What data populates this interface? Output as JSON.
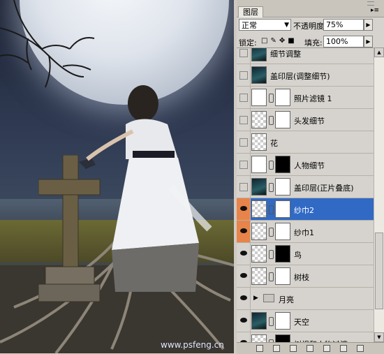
{
  "canvas": {
    "watermark": "www.psfeng.cn"
  },
  "panel": {
    "tab_label": "图层",
    "menu_icon": "panel-menu-icon",
    "blend_mode": "正常",
    "opacity_label": "不透明度:",
    "opacity_value": "75%",
    "lock_label": "锁定:",
    "fill_label": "填充:",
    "fill_value": "100%"
  },
  "layers": [
    {
      "name": "细节调整",
      "visible": false,
      "thumb": "image",
      "mask": null,
      "active": false
    },
    {
      "name": "盖印层(调整细节)",
      "visible": false,
      "thumb": "image",
      "mask": null,
      "active": false
    },
    {
      "name": "照片滤镜 1",
      "visible": false,
      "thumb": "adjustment",
      "mask": "white",
      "active": false
    },
    {
      "name": "头发细节",
      "visible": false,
      "thumb": "checker",
      "mask": "white",
      "active": false
    },
    {
      "name": "花",
      "visible": false,
      "thumb": "checker",
      "mask": null,
      "active": false
    },
    {
      "name": "人物细节",
      "visible": false,
      "thumb": "histogram",
      "mask": "black",
      "active": false
    },
    {
      "name": "盖印层(正片叠底)",
      "visible": false,
      "thumb": "image",
      "mask": "white",
      "active": false
    },
    {
      "name": "纱巾2",
      "visible": true,
      "thumb": "checker",
      "mask": "white",
      "active": true
    },
    {
      "name": "纱巾1",
      "visible": true,
      "thumb": "checker",
      "mask": "white",
      "active": false
    },
    {
      "name": "鸟",
      "visible": true,
      "thumb": "checker",
      "mask": "black",
      "active": false
    },
    {
      "name": "树枝",
      "visible": true,
      "thumb": "checker",
      "mask": "white",
      "active": false
    },
    {
      "name": "月亮",
      "visible": true,
      "thumb": "folder",
      "mask": null,
      "active": false
    },
    {
      "name": "天空",
      "visible": true,
      "thumb": "image",
      "mask": "white",
      "active": false
    },
    {
      "name": "树根和人物过渡",
      "visible": true,
      "thumb": "checker",
      "mask": "black",
      "active": false
    }
  ]
}
